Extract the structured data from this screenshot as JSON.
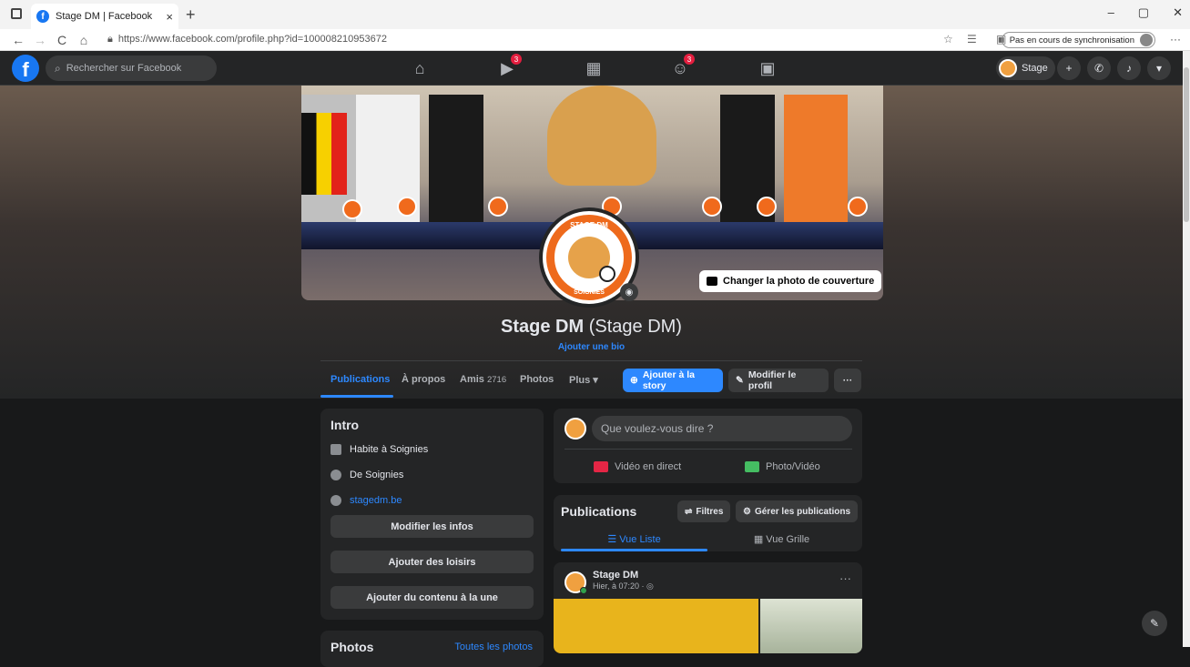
{
  "browser": {
    "tab_title": "Stage DM | Facebook",
    "tab_close": "×",
    "new_tab": "+",
    "url": "https://www.facebook.com/profile.php?id=100008210953672",
    "sync_status": "Pas en cours de synchronisation",
    "min": "–",
    "max": "▢",
    "close": "✕",
    "more": "···",
    "back": "←",
    "forward": "→",
    "refresh": "C",
    "home": "⌂"
  },
  "fb_header": {
    "logo": "f",
    "search_placeholder": "Rechercher sur Facebook",
    "nav": [
      {
        "icon": "home-icon",
        "glyph": "⌂",
        "badge": ""
      },
      {
        "icon": "watch-icon",
        "glyph": "▶",
        "badge": "3"
      },
      {
        "icon": "marketplace-icon",
        "glyph": "▦",
        "badge": ""
      },
      {
        "icon": "groups-icon",
        "glyph": "☺",
        "badge": "3"
      },
      {
        "icon": "gaming-icon",
        "glyph": "▣",
        "badge": ""
      }
    ],
    "profile_name": "Stage",
    "create": "+",
    "messenger": "✆",
    "notifications": "♪",
    "account": "▾"
  },
  "cover": {
    "change_cover": "Changer la photo de couverture",
    "avatar_top_text": "STAGE DM",
    "avatar_bottom_text": "SOIGNIES"
  },
  "profile": {
    "name": "Stage DM",
    "alt_name": "(Stage DM)",
    "bio_link": "Ajouter une bio"
  },
  "tabs": {
    "publications": "Publications",
    "about": "À propos",
    "friends": "Amis",
    "friends_count": "2716",
    "photos": "Photos",
    "more": "Plus ▾",
    "add_story": "Ajouter à la story",
    "edit_profile": "Modifier le profil",
    "more_dots": "···"
  },
  "intro": {
    "title": "Intro",
    "lives": "Habite à Soignies",
    "from": "De Soignies",
    "website": "stagedm.be",
    "edit_info": "Modifier les infos",
    "add_hobbies": "Ajouter des loisirs",
    "add_featured": "Ajouter du contenu à la une"
  },
  "photos_card": {
    "title": "Photos",
    "see_all": "Toutes les photos"
  },
  "composer": {
    "placeholder": "Que voulez-vous dire ?",
    "live_video": "Vidéo en direct",
    "photo_video": "Photo/Vidéo"
  },
  "publications": {
    "title": "Publications",
    "filters": "Filtres",
    "manage": "Gérer les publications",
    "list_view": "☰ Vue Liste",
    "grid_view": "▦ Vue Grille"
  },
  "post": {
    "author": "Stage DM",
    "time": "Hier, à 07:20 · ◎",
    "more": "···"
  },
  "fab": "✎"
}
